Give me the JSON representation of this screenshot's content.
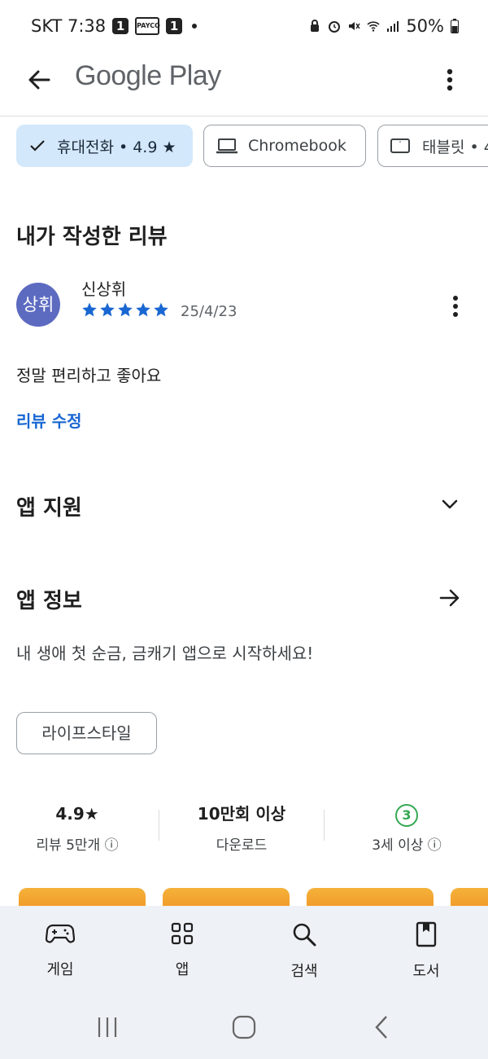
{
  "status_bar": {
    "carrier_time": "SKT 7:38",
    "badge1": "1",
    "badge_payco": "PAYCO",
    "badge2": "1",
    "battery": "50%"
  },
  "app_bar": {
    "title": "Google Play"
  },
  "device_chips": [
    {
      "label": "휴대전화 • 4.9 ★",
      "selected": true
    },
    {
      "label": "Chromebook",
      "selected": false
    },
    {
      "label": "태블릿 • 4",
      "selected": false
    }
  ],
  "my_review": {
    "heading": "내가 작성한 리뷰",
    "avatar_text": "상휘",
    "author": "신상휘",
    "rating": 5,
    "date": "25/4/23",
    "body": "정말 편리하고 좋아요",
    "edit_label": "리뷰 수정"
  },
  "app_support": {
    "heading": "앱 지원"
  },
  "about": {
    "heading": "앱 정보",
    "description": "내 생애 첫 순금, 금캐기 앱으로 시작하세요!",
    "category_tag": "라이프스타일"
  },
  "stats": [
    {
      "value": "4.9★",
      "label": "리뷰 5만개 ⓘ"
    },
    {
      "value": "10만회 이상",
      "label": "다운로드"
    },
    {
      "value": "3",
      "label": "3세 이상 ⓘ"
    }
  ],
  "bottom_nav": [
    {
      "label": "게임",
      "icon": "gamepad-icon"
    },
    {
      "label": "앱",
      "icon": "apps-grid-icon"
    },
    {
      "label": "검색",
      "icon": "search-icon"
    },
    {
      "label": "도서",
      "icon": "book-icon"
    }
  ],
  "colors": {
    "selected_chip": "#d3e8fb",
    "star": "#1967d2",
    "link": "#1967d2",
    "avatar": "#5c6bc0",
    "age_green": "#34a853",
    "promo": "#f4b23a"
  }
}
